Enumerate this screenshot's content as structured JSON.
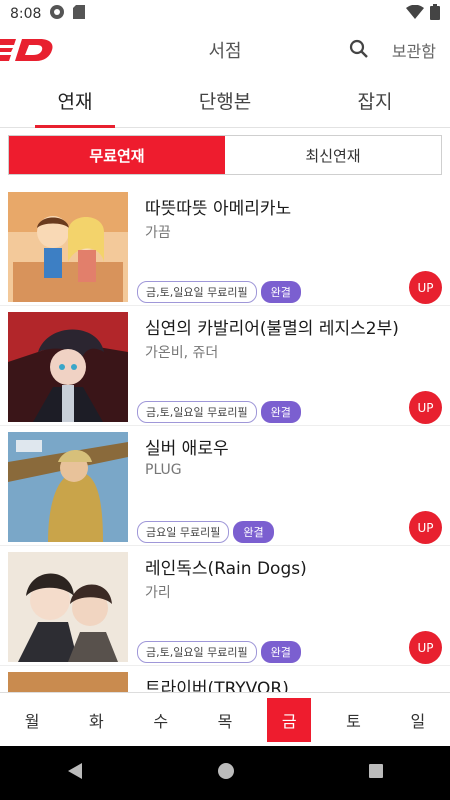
{
  "status_bar": {
    "time": "8:08"
  },
  "header": {
    "title": "서점",
    "storage_label": "보관함"
  },
  "main_tabs": [
    {
      "label": "연재",
      "active": true
    },
    {
      "label": "단행본",
      "active": false
    },
    {
      "label": "잡지",
      "active": false
    }
  ],
  "segment": [
    {
      "label": "무료연재",
      "active": true
    },
    {
      "label": "최신연재",
      "active": false
    }
  ],
  "items": [
    {
      "title": "따뜻따뜻 아메리카노",
      "author": "가끔",
      "free_tag": "금,토,일요일 무료리필",
      "status_tag": "완결",
      "badge": "UP"
    },
    {
      "title": "심연의 카발리어(불멸의 레지스2부)",
      "author": "가온비, 쥬더",
      "free_tag": "금,토,일요일 무료리필",
      "status_tag": "완결",
      "badge": "UP"
    },
    {
      "title": "실버 애로우",
      "author": "PLUG",
      "free_tag": "금요일 무료리필",
      "status_tag": "완결",
      "badge": "UP"
    },
    {
      "title": "레인독스(Rain Dogs)",
      "author": "가리",
      "free_tag": "금,토,일요일 무료리필",
      "status_tag": "완결",
      "badge": "UP"
    },
    {
      "title": "트라이버(TRYVOR)",
      "author": "",
      "free_tag": "",
      "status_tag": "",
      "badge": ""
    }
  ],
  "day_tabs": [
    {
      "label": "월",
      "active": false
    },
    {
      "label": "화",
      "active": false
    },
    {
      "label": "수",
      "active": false
    },
    {
      "label": "목",
      "active": false
    },
    {
      "label": "금",
      "active": true
    },
    {
      "label": "토",
      "active": false
    },
    {
      "label": "일",
      "active": false
    }
  ],
  "colors": {
    "accent": "#ee1c2e",
    "tag_purple": "#7b5fd0"
  },
  "icons": [
    "app-logo-icon",
    "search-icon",
    "wifi-icon",
    "battery-icon",
    "back-icon",
    "home-icon",
    "recents-icon"
  ]
}
